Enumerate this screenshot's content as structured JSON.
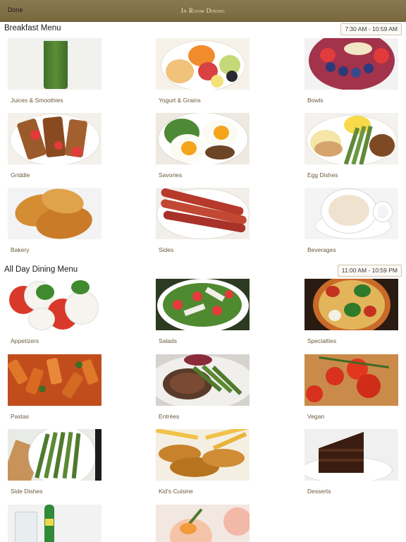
{
  "header": {
    "done_label": "Done",
    "title": "In Room Dining"
  },
  "sections": [
    {
      "title": "Breakfast Menu",
      "hours": "7:30 AM - 10:59 AM",
      "items": [
        "Juices & Smoothies",
        "Yogurt & Grains",
        "Bowls",
        "Griddle",
        "Savories",
        "Egg Dishes",
        "Bakery",
        "Sides",
        "Beverages"
      ]
    },
    {
      "title": "All Day Dining Menu",
      "hours": "11:00 AM - 10:59 PM",
      "items": [
        "Appetizers",
        "Salads",
        "Specialties",
        "Pastas",
        "Entrées",
        "Vegan",
        "Side Dishes",
        "Kid's Cuisine",
        "Desserts"
      ]
    }
  ]
}
